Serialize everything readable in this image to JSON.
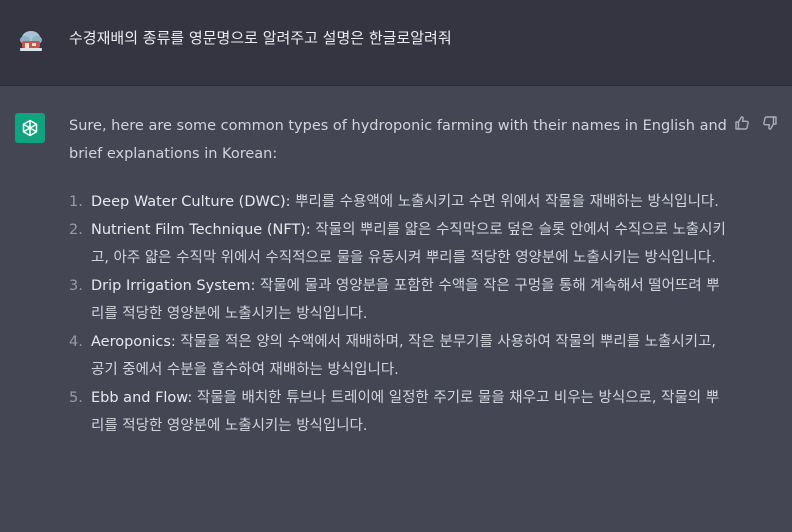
{
  "user_message": {
    "text": "수경재배의 종류를 영문명으로 알려주고 설명은 한글로알려줘"
  },
  "assistant_message": {
    "intro": "Sure, here are some common types of hydroponic farming with their names in English and brief explanations in Korean:",
    "items": [
      {
        "number": "1.",
        "term": "Deep Water Culture (DWC):",
        "description": " 뿌리를 수용액에 노출시키고 수면 위에서 작물을 재배하는 방식입니다."
      },
      {
        "number": "2.",
        "term": "Nutrient Film Technique (NFT):",
        "description": " 작물의 뿌리를 얇은 수직막으로 덮은 슬롯 안에서 수직으로 노출시키고, 아주 얇은 수직막 위에서 수직적으로 물을 유동시켜 뿌리를 적당한 영양분에 노출시키는 방식입니다."
      },
      {
        "number": "3.",
        "term": "Drip Irrigation System:",
        "description": " 작물에 물과 영양분을 포함한 수액을 작은 구멍을 통해 계속해서 떨어뜨려 뿌리를 적당한 영양분에 노출시키는 방식입니다."
      },
      {
        "number": "4.",
        "term": "Aeroponics:",
        "description": " 작물을 적은 양의 수액에서 재배하며, 작은 분무기를 사용하여 작물의 뿌리를 노출시키고, 공기 중에서 수분을 흡수하여 재배하는 방식입니다."
      },
      {
        "number": "5.",
        "term": "Ebb and Flow:",
        "description": " 작물을 배치한 튜브나 트레이에 일정한 주기로 물을 채우고 비우는 방식으로, 작물의 뿌리를 적당한 영양분에 노출시키는 방식입니다."
      }
    ]
  },
  "icons": {
    "user_avatar": "user-avatar-icon",
    "assistant_avatar": "openai-logo-icon",
    "thumbs_up": "thumbs-up-icon",
    "thumbs_down": "thumbs-down-icon"
  },
  "colors": {
    "user_row_bg": "#343541",
    "assistant_row_bg": "#444654",
    "gpt_avatar_bg": "#10a37f",
    "text": "#d1d5db"
  }
}
